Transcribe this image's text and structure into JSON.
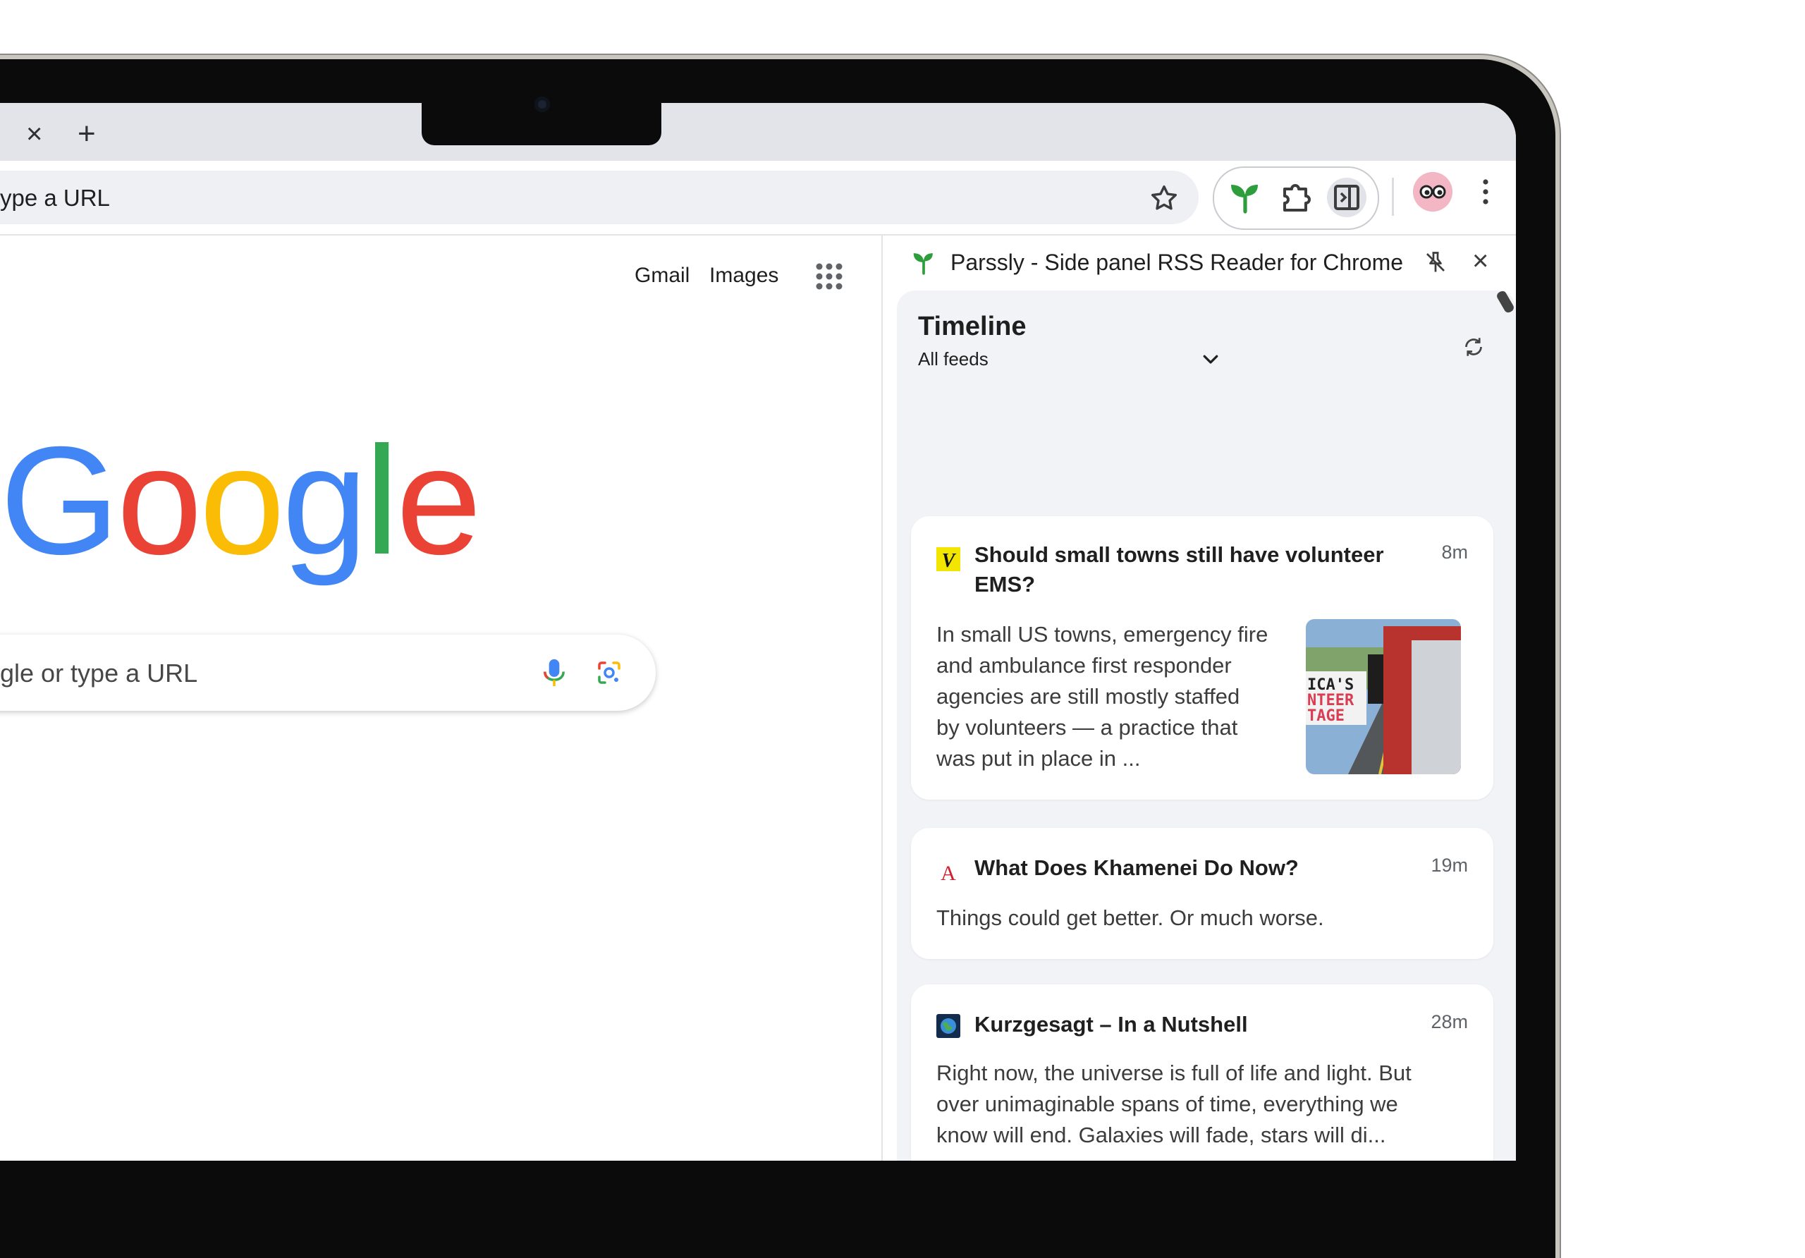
{
  "browser": {
    "omnibox_text": "ype a URL",
    "tab_close": "×",
    "tab_new": "+"
  },
  "page": {
    "gmail_link": "Gmail",
    "images_link": "Images",
    "logo_letters": [
      "G",
      "o",
      "o",
      "g",
      "l",
      "e"
    ],
    "logo_colors": [
      "#4285f4",
      "#ea4335",
      "#fbbc05",
      "#4285f4",
      "#34a853",
      "#ea4335"
    ],
    "search_placeholder": "gle or type a URL"
  },
  "side_panel": {
    "title": "Parssly - Side panel RSS Reader for Chrome",
    "close": "×",
    "timeline_title": "Timeline",
    "feed_selector": "All feeds",
    "cards": [
      {
        "source_icon": "verge-v-icon",
        "title_lines": [
          "Should small towns still have volunteer",
          "EMS?"
        ],
        "time": "8m",
        "desc_lines": [
          "In small US towns, emergency fire",
          "and ambulance first responder",
          "agencies are still mostly staffed",
          "by volunteers — a practice that",
          "was put in place in ..."
        ],
        "thumb_text": [
          "ICA'S",
          "NTEER",
          "TAGE"
        ]
      },
      {
        "source_icon": "atlantic-a-icon",
        "title_lines": [
          "What Does Khamenei Do Now?"
        ],
        "time": "19m",
        "desc_lines": [
          "Things could get better. Or much worse."
        ]
      },
      {
        "source_icon": "kurzgesagt-globe-icon",
        "title_lines": [
          "Kurzgesagt – In a Nutshell"
        ],
        "time": "28m",
        "desc_lines": [
          "Right now, the universe is full of life and light. But",
          "over unimaginable spans of time, everything we",
          "know will end. Galaxies will fade, stars will di..."
        ]
      }
    ]
  },
  "colors": {
    "accent_green": "#2e9e3c",
    "card_bg": "#ffffff",
    "panel_bg": "#f1f3f6"
  }
}
